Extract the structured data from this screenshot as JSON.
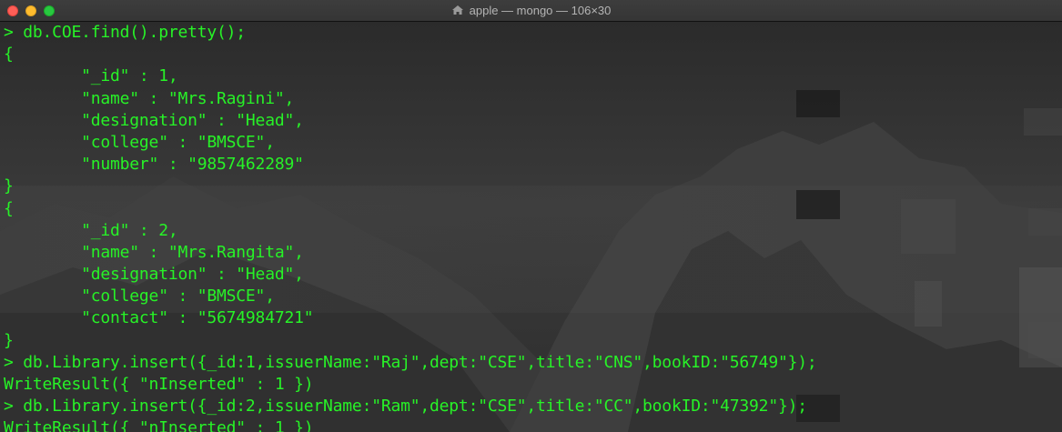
{
  "window": {
    "title": "apple — mongo — 106×30",
    "title_icon": "home-icon",
    "controls": [
      "close",
      "minimize",
      "zoom"
    ]
  },
  "colors": {
    "terminal_text": "#27f227",
    "titlebar": "#383838"
  },
  "terminal": {
    "lines": [
      "> db.COE.find().pretty();",
      "{",
      "        \"_id\" : 1,",
      "        \"name\" : \"Mrs.Ragini\",",
      "        \"designation\" : \"Head\",",
      "        \"college\" : \"BMSCE\",",
      "        \"number\" : \"9857462289\"",
      "}",
      "{",
      "        \"_id\" : 2,",
      "        \"name\" : \"Mrs.Rangita\",",
      "        \"designation\" : \"Head\",",
      "        \"college\" : \"BMSCE\",",
      "        \"contact\" : \"5674984721\"",
      "}",
      "> db.Library.insert({_id:1,issuerName:\"Raj\",dept:\"CSE\",title:\"CNS\",bookID:\"56749\"});",
      "WriteResult({ \"nInserted\" : 1 })",
      "> db.Library.insert({_id:2,issuerName:\"Ram\",dept:\"CSE\",title:\"CC\",bookID:\"47392\"});",
      "WriteResult({ \"nInserted\" : 1 })"
    ]
  }
}
